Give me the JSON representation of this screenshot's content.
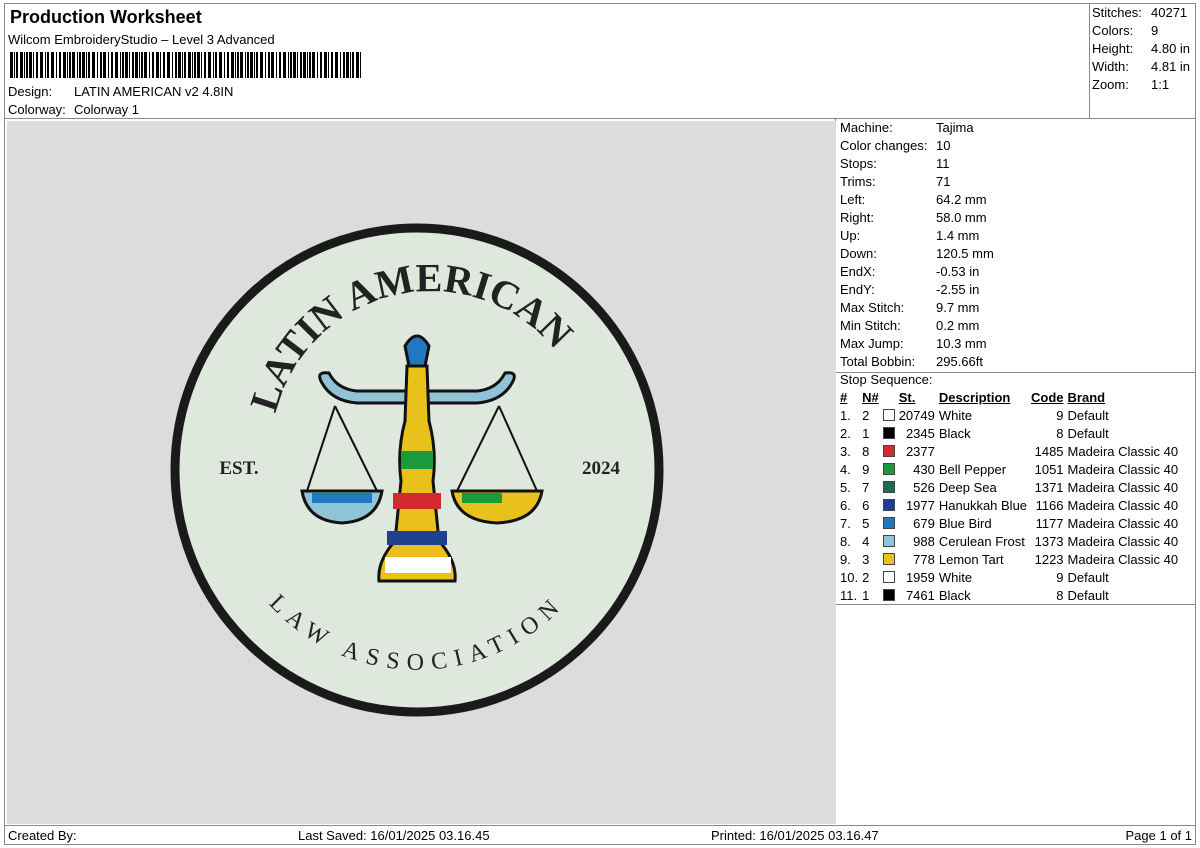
{
  "header": {
    "title": "Production Worksheet",
    "software": "Wilcom EmbroideryStudio – Level 3 Advanced",
    "design_label": "Design:",
    "design_value": "LATIN AMERICAN v2 4.8IN",
    "colorway_label": "Colorway:",
    "colorway_value": "Colorway 1"
  },
  "summary": [
    {
      "label": "Stitches:",
      "value": "40271"
    },
    {
      "label": "Colors:",
      "value": "9"
    },
    {
      "label": "Height:",
      "value": "4.80 in"
    },
    {
      "label": "Width:",
      "value": "4.81 in"
    },
    {
      "label": "Zoom:",
      "value": "1:1"
    }
  ],
  "design_art": {
    "top_text": "LATIN AMERICAN",
    "bottom_text": "LAW ASSOCIATION",
    "left_text": "EST.",
    "right_text": "2024"
  },
  "machine": [
    {
      "label": "Machine:",
      "value": "Tajima"
    },
    {
      "label": "Color changes:",
      "value": "10"
    },
    {
      "label": "Stops:",
      "value": "11"
    },
    {
      "label": "Trims:",
      "value": "71"
    },
    {
      "label": "Left:",
      "value": "64.2 mm"
    },
    {
      "label": "Right:",
      "value": "58.0 mm"
    },
    {
      "label": "Up:",
      "value": "1.4 mm"
    },
    {
      "label": "Down:",
      "value": "120.5 mm"
    },
    {
      "label": "EndX:",
      "value": "-0.53 in"
    },
    {
      "label": "EndY:",
      "value": "-2.55 in"
    },
    {
      "label": "Max Stitch:",
      "value": "9.7 mm"
    },
    {
      "label": "Min Stitch:",
      "value": "0.2 mm"
    },
    {
      "label": "Max Jump:",
      "value": "10.3 mm"
    },
    {
      "label": "Total Bobbin:",
      "value": "295.66ft"
    }
  ],
  "stop_sequence": {
    "title": "Stop Sequence:",
    "headers": {
      "num": "#",
      "n": "N#",
      "st": "St.",
      "desc": "Description",
      "code": "Code",
      "brand": "Brand"
    },
    "rows": [
      {
        "num": "1.",
        "n": "2",
        "color": "#ffffff",
        "st": "20749",
        "desc": "White",
        "code": "9",
        "brand": "Default"
      },
      {
        "num": "2.",
        "n": "1",
        "color": "#000000",
        "st": "2345",
        "desc": "Black",
        "code": "8",
        "brand": "Default"
      },
      {
        "num": "3.",
        "n": "8",
        "color": "#d42a2f",
        "st": "2377",
        "desc": "",
        "code": "1485",
        "brand": "Madeira Classic 40"
      },
      {
        "num": "4.",
        "n": "9",
        "color": "#1a9a3c",
        "st": "430",
        "desc": "Bell Pepper",
        "code": "1051",
        "brand": "Madeira Classic 40"
      },
      {
        "num": "5.",
        "n": "7",
        "color": "#1e6b55",
        "st": "526",
        "desc": "Deep Sea",
        "code": "1371",
        "brand": "Madeira Classic 40"
      },
      {
        "num": "6.",
        "n": "6",
        "color": "#1f3f8f",
        "st": "1977",
        "desc": "Hanukkah Blue",
        "code": "1166",
        "brand": "Madeira Classic 40"
      },
      {
        "num": "7.",
        "n": "5",
        "color": "#1f78c0",
        "st": "679",
        "desc": "Blue Bird",
        "code": "1177",
        "brand": "Madeira Classic 40"
      },
      {
        "num": "8.",
        "n": "4",
        "color": "#8fc3d6",
        "st": "988",
        "desc": "Cerulean Frost",
        "code": "1373",
        "brand": "Madeira Classic 40"
      },
      {
        "num": "9.",
        "n": "3",
        "color": "#e8c21a",
        "st": "778",
        "desc": "Lemon Tart",
        "code": "1223",
        "brand": "Madeira Classic 40"
      },
      {
        "num": "10.",
        "n": "2",
        "color": "#ffffff",
        "st": "1959",
        "desc": "White",
        "code": "9",
        "brand": "Default"
      },
      {
        "num": "11.",
        "n": "1",
        "color": "#000000",
        "st": "7461",
        "desc": "Black",
        "code": "8",
        "brand": "Default"
      }
    ]
  },
  "footer": {
    "created": "Created By:",
    "saved": "Last Saved: 16/01/2025 03.16.45",
    "printed": "Printed: 16/01/2025 03.16.47",
    "page": "Page 1 of 1"
  }
}
